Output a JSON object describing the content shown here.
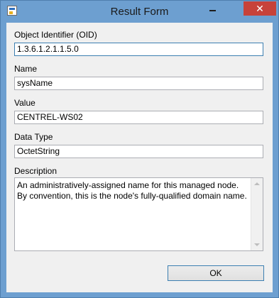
{
  "window": {
    "title": "Result Form",
    "close_glyph": "✕",
    "icons": {
      "app": "app-form-icon",
      "minimize": "minimize-icon",
      "close": "close-icon"
    }
  },
  "form": {
    "oid": {
      "label": "Object Identifier (OID)",
      "value": "1.3.6.1.2.1.1.5.0"
    },
    "name": {
      "label": "Name",
      "value": "sysName"
    },
    "value": {
      "label": "Value",
      "value": "CENTREL-WS02"
    },
    "data_type": {
      "label": "Data Type",
      "value": "OctetString"
    },
    "description": {
      "label": "Description",
      "value": "An administratively-assigned name for this managed node. By convention, this is the node's fully-qualified domain name."
    }
  },
  "buttons": {
    "ok_label": "OK"
  },
  "colors": {
    "title_bar": "#6d9fd0",
    "close_button": "#c7423a",
    "focus_border": "#3c7fb1"
  }
}
